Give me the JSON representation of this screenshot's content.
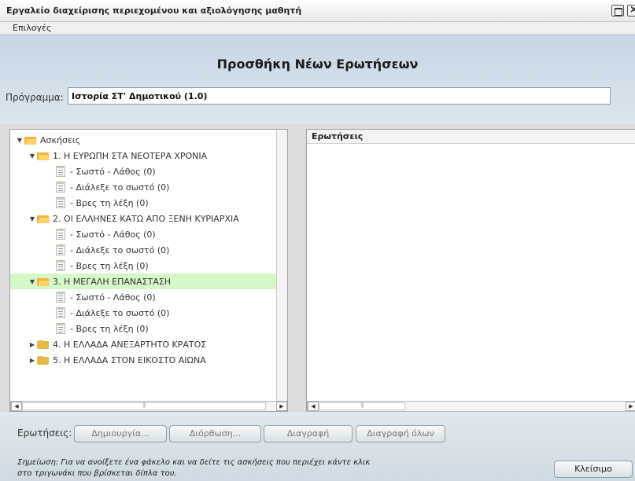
{
  "window": {
    "title": "Εργαλείο διαχείρισης περιεχομένου και αξιολόγησης μαθητή"
  },
  "menubar": {
    "options_label": "Επιλογές"
  },
  "header": {
    "title": "Προσθήκη Νέων Ερωτήσεων"
  },
  "program": {
    "label": "Πρόγραμμα:",
    "value": "Ιστορία ΣΤ' Δημοτικού (1.0)"
  },
  "tree": {
    "root": "Ασκήσεις",
    "chapters": [
      {
        "label": "1. Η ΕΥΡΩΠΗ ΣΤΑ ΝΕΟΤΕΡΑ ΧΡΟΝΙΑ",
        "expanded": true,
        "selected": false,
        "items": [
          "- Σωστό - Λάθος  (0)",
          "- Διάλεξε το σωστό  (0)",
          "- Βρες τη λέξη  (0)"
        ]
      },
      {
        "label": "2. ΟΙ ΕΛΛΗΝΕΣ ΚΑΤΩ ΑΠΟ ΞΕΝΗ ΚΥΡΙΑΡΧΙΑ",
        "expanded": true,
        "selected": false,
        "items": [
          "- Σωστό - Λάθος  (0)",
          "- Διάλεξε το σωστό  (0)",
          "- Βρες τη λέξη  (0)"
        ]
      },
      {
        "label": "3. Η ΜΕΓΑΛΗ ΕΠΑΝΑΣΤΑΣΗ",
        "expanded": true,
        "selected": true,
        "items": [
          "- Σωστό - Λάθος  (0)",
          "- Διάλεξε το σωστό  (0)",
          "- Βρες τη λέξη  (0)"
        ]
      },
      {
        "label": "4. Η ΕΛΛΑΔΑ ΑΝΕΞΑΡΤΗΤΟ ΚΡΑΤΟΣ",
        "expanded": false,
        "selected": false,
        "items": []
      },
      {
        "label": "5. Η ΕΛΛΑΔΑ ΣΤΟΝ ΕΙΚΟΣΤΟ ΑΙΩΝΑ",
        "expanded": false,
        "selected": false,
        "items": []
      }
    ]
  },
  "questions_panel": {
    "header": "Ερωτήσεις"
  },
  "toolbar": {
    "label": "Ερωτήσεις:",
    "create_label": "Δημιουργία...",
    "edit_label": "Διόρθωση...",
    "delete_label": "Διαγραφή",
    "delete_all_label": "Διαγραφή όλων",
    "close_label": "Κλείσιμο"
  },
  "note": {
    "line1": "Σημείωση: Για να ανοίξετε ένα φάκελο και να δείτε τις ασκήσεις που περιέχει κάντε κλικ",
    "line2": "στο τριγωνάκι που βρίσκεται δίπλα του."
  },
  "colors": {
    "selected_row": "#d6f7c8",
    "header_band": "#c6d6e2",
    "folder": "#f0b63c"
  }
}
